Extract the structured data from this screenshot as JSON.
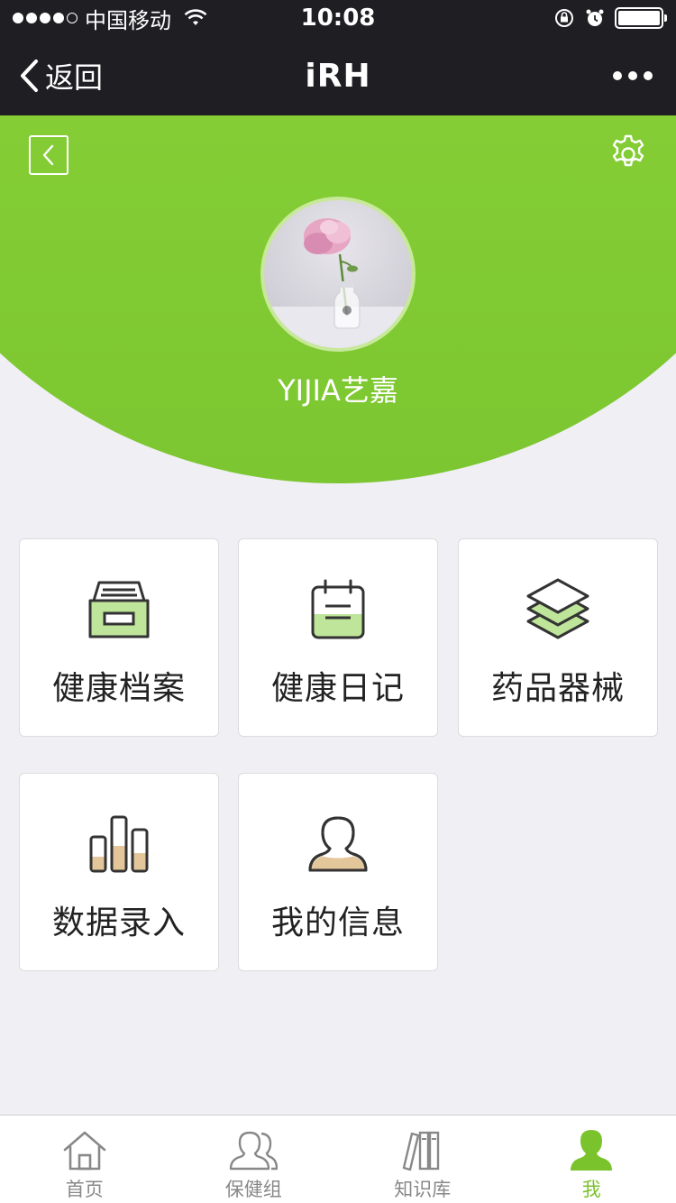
{
  "status_bar": {
    "carrier": "中国移动",
    "time": "10:08"
  },
  "nav_bar": {
    "back_label": "返回",
    "title": "iRH"
  },
  "profile": {
    "username": "YIJIA艺嘉"
  },
  "menu": [
    {
      "label": "健康档案",
      "icon": "archive-box-icon"
    },
    {
      "label": "健康日记",
      "icon": "calendar-icon"
    },
    {
      "label": "药品器械",
      "icon": "layers-icon"
    },
    {
      "label": "数据录入",
      "icon": "bar-chart-icon"
    },
    {
      "label": "我的信息",
      "icon": "person-icon"
    }
  ],
  "tabs": [
    {
      "label": "首页",
      "icon": "home-icon"
    },
    {
      "label": "保健组",
      "icon": "group-icon"
    },
    {
      "label": "知识库",
      "icon": "books-icon"
    },
    {
      "label": "我",
      "icon": "person-filled-icon",
      "active": true
    }
  ],
  "colors": {
    "accent_green": "#84cd35",
    "tab_active": "#7ac32d",
    "dark_bar": "#1f1e23",
    "icon_fill_green": "#bfe59a",
    "icon_fill_tan": "#e3c79b"
  }
}
